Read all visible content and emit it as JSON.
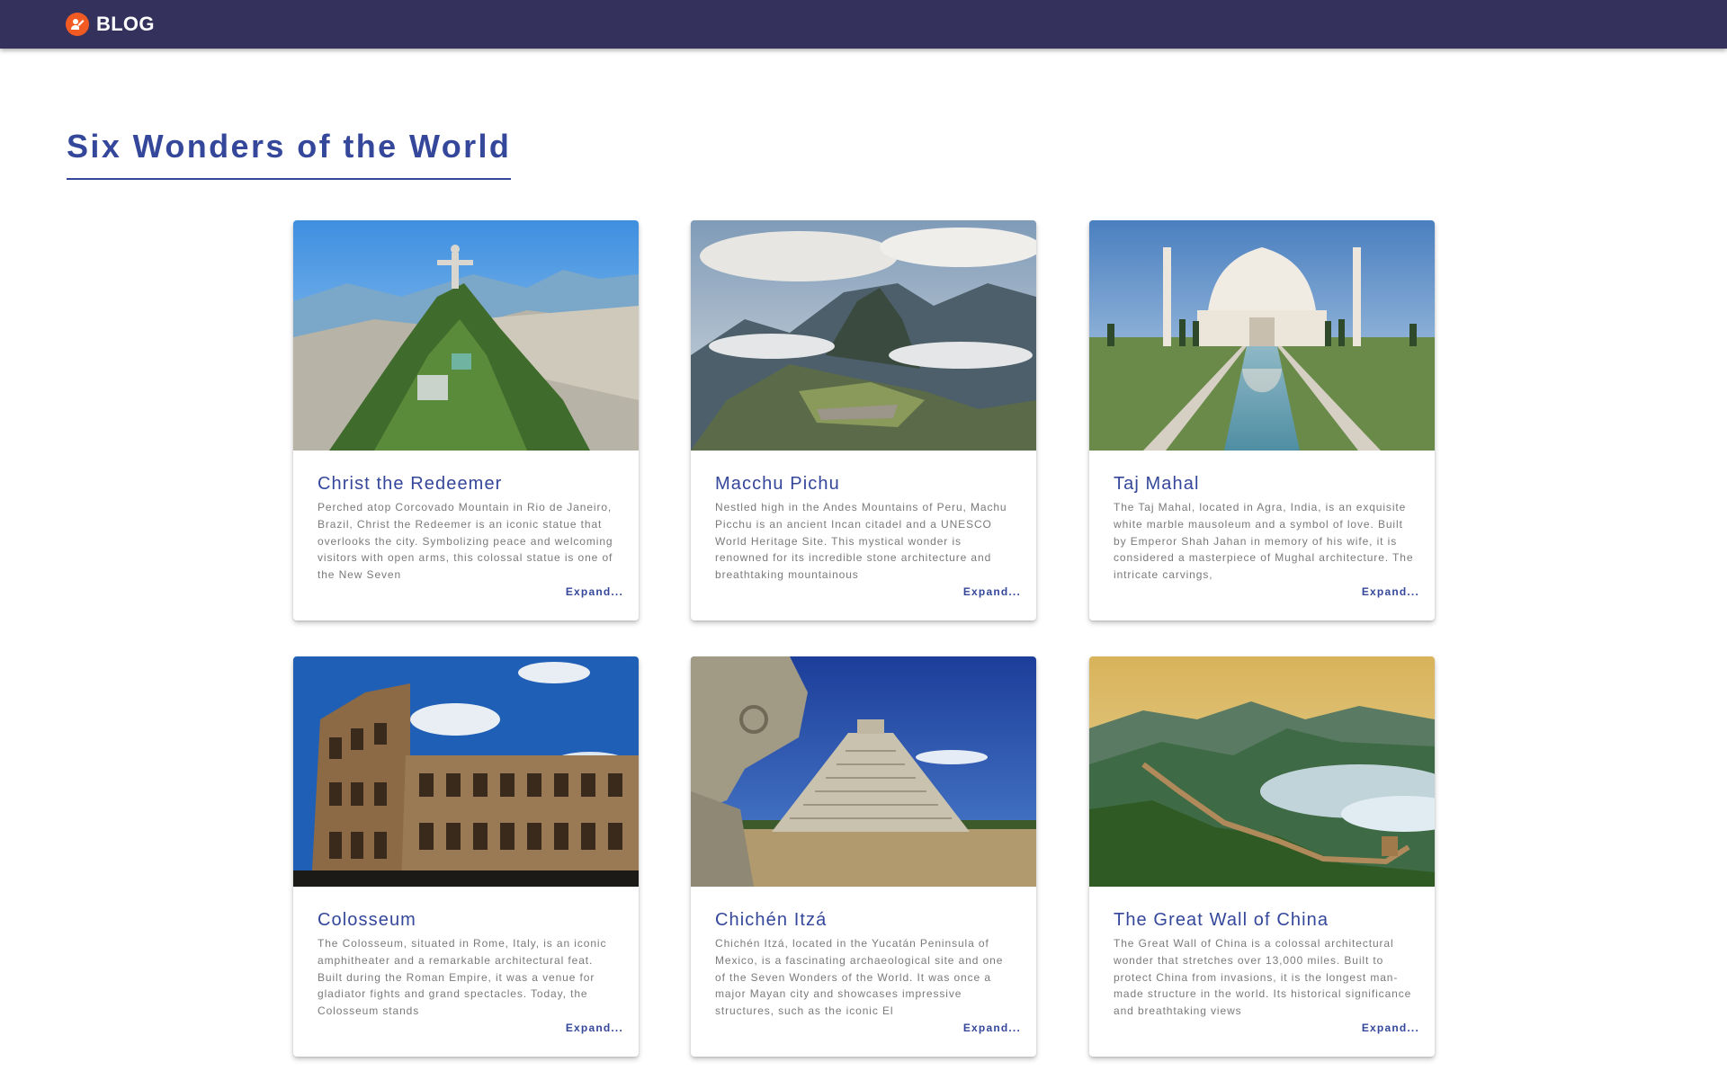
{
  "brand": {
    "name": "BLOG",
    "logo_icon": "blog-logo-icon",
    "logo_color": "#f25a23"
  },
  "header_color": "#34325d",
  "accent_color": "#34479a",
  "page": {
    "title": "Six Wonders of the World"
  },
  "cards": [
    {
      "title": "Christ the Redeemer",
      "description": "Perched atop Corcovado Mountain in Rio de Janeiro, Brazil, Christ the Redeemer is an iconic statue that overlooks the city. Symbolizing peace and welcoming visitors with open arms, this colossal statue is one of the New Seven",
      "expand": "Expand..."
    },
    {
      "title": "Macchu Pichu",
      "description": "Nestled high in the Andes Mountains of Peru, Machu Picchu is an ancient Incan citadel and a UNESCO World Heritage Site. This mystical wonder is renowned for its incredible stone architecture and breathtaking mountainous",
      "expand": "Expand..."
    },
    {
      "title": "Taj Mahal",
      "description": "The Taj Mahal, located in Agra, India, is an exquisite white marble mausoleum and a symbol of love. Built by Emperor Shah Jahan in memory of his wife, it is considered a masterpiece of Mughal architecture. The intricate carvings,",
      "expand": "Expand..."
    },
    {
      "title": "Colosseum",
      "description": "The Colosseum, situated in Rome, Italy, is an iconic amphitheater and a remarkable architectural feat. Built during the Roman Empire, it was a venue for gladiator fights and grand spectacles. Today, the Colosseum stands",
      "expand": "Expand..."
    },
    {
      "title": "Chichén Itzá",
      "description": "Chichén Itzá, located in the Yucatán Peninsula of Mexico, is a fascinating archaeological site and one of the Seven Wonders of the World. It was once a major Mayan city and showcases impressive structures, such as the iconic El",
      "expand": "Expand..."
    },
    {
      "title": "The Great Wall of China",
      "description": "The Great Wall of China is a colossal architectural wonder that stretches over 13,000 miles. Built to protect China from invasions, it is the longest man-made structure in the world. Its historical significance and breathtaking views",
      "expand": "Expand..."
    }
  ]
}
